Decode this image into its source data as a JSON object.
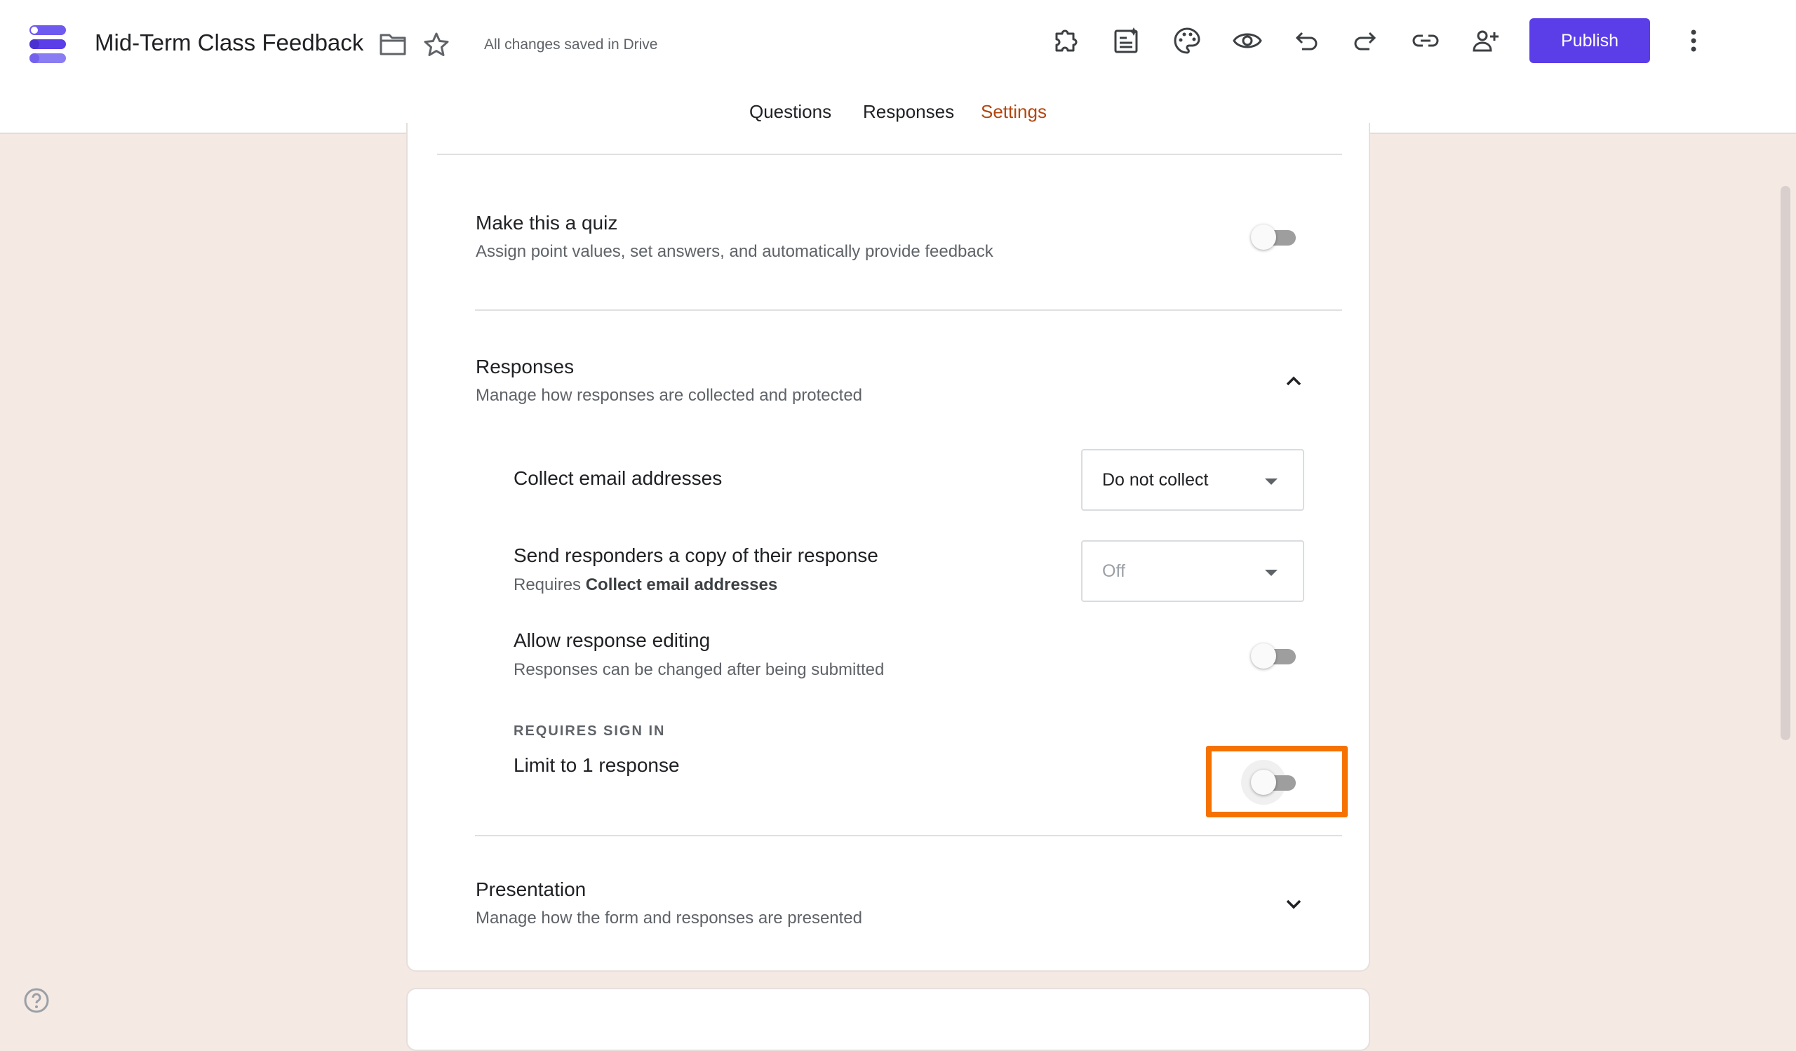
{
  "header": {
    "title": "Mid-Term Class Feedback",
    "save_status": "All changes saved in Drive",
    "publish_label": "Publish",
    "icons": [
      "addon-icon",
      "customize-ai-icon",
      "palette-icon",
      "preview-icon",
      "undo-icon",
      "redo-icon",
      "link-icon",
      "add-collaborator-icon",
      "more-vert-icon"
    ]
  },
  "tabs": [
    {
      "label": "Questions",
      "active": false
    },
    {
      "label": "Responses",
      "active": false
    },
    {
      "label": "Settings",
      "active": true
    }
  ],
  "colors": {
    "accent": "#5b3ee8",
    "active_tab": "#b3460e",
    "highlight": "#f57200",
    "background": "#f5e9e4"
  },
  "settings": {
    "quiz": {
      "title": "Make this a quiz",
      "desc": "Assign point values, set answers, and automatically provide feedback",
      "enabled": false
    },
    "responses": {
      "title": "Responses",
      "desc": "Manage how responses are collected and protected",
      "expanded": true,
      "collect_email": {
        "label": "Collect email addresses",
        "value": "Do not collect"
      },
      "send_copy": {
        "label": "Send responders a copy of their response",
        "desc_prefix": "Requires",
        "desc_bold": "Collect email addresses",
        "value": "Off"
      },
      "allow_editing": {
        "label": "Allow response editing",
        "desc": "Responses can be changed after being submitted",
        "enabled": false
      },
      "requires_sign_in": "REQUIRES SIGN IN",
      "limit_one": {
        "label": "Limit to 1 response",
        "enabled": false
      }
    },
    "presentation": {
      "title": "Presentation",
      "desc": "Manage how the form and responses are presented",
      "expanded": false
    }
  }
}
